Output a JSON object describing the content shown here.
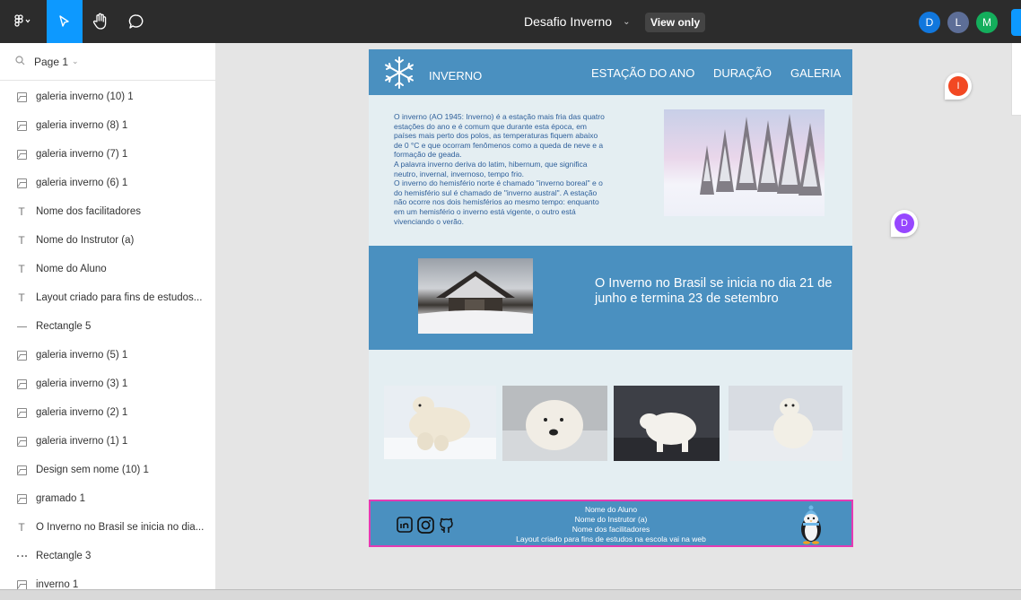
{
  "topbar": {
    "file_title": "Desafio Inverno",
    "view_only_label": "View only",
    "avatars": [
      {
        "initial": "D",
        "color": "#1177dd"
      },
      {
        "initial": "L",
        "color": "#5d6e97"
      },
      {
        "initial": "M",
        "color": "#14ae5c"
      }
    ]
  },
  "leftpanel": {
    "page_label": "Page 1",
    "layers": [
      {
        "icon": "image-icon",
        "label": "galeria inverno (10) 1"
      },
      {
        "icon": "image-icon",
        "label": "galeria inverno (8) 1"
      },
      {
        "icon": "image-icon",
        "label": "galeria inverno (7) 1"
      },
      {
        "icon": "image-icon",
        "label": "galeria inverno (6) 1"
      },
      {
        "icon": "text-icon",
        "label": "Nome dos facilitadores"
      },
      {
        "icon": "text-icon",
        "label": "Nome do Instrutor (a)"
      },
      {
        "icon": "text-icon",
        "label": "Nome do Aluno"
      },
      {
        "icon": "text-icon",
        "label": "Layout criado para fins de estudos..."
      },
      {
        "icon": "line-icon",
        "label": "Rectangle 5"
      },
      {
        "icon": "image-icon",
        "label": "galeria inverno (5) 1"
      },
      {
        "icon": "image-icon",
        "label": "galeria inverno (3) 1"
      },
      {
        "icon": "image-icon",
        "label": "galeria inverno (2) 1"
      },
      {
        "icon": "image-icon",
        "label": "galeria inverno (1) 1"
      },
      {
        "icon": "image-icon",
        "label": "Design sem nome (10) 1"
      },
      {
        "icon": "image-icon",
        "label": "gramado 1"
      },
      {
        "icon": "text-icon",
        "label": "O Inverno no Brasil se inicia no dia..."
      },
      {
        "icon": "dashed-line-icon",
        "label": "Rectangle 3"
      },
      {
        "icon": "image-icon",
        "label": "inverno 1"
      }
    ]
  },
  "design": {
    "brand": "INVERNO",
    "nav": [
      "ESTAÇÃO DO ANO",
      "DURAÇÃO",
      "GALERIA"
    ],
    "intro_lines": [
      "O inverno (AO 1945: Inverno) é a estação mais fria das quatro",
      "estações do ano e é comum que durante esta época, em",
      "países mais perto dos polos, as temperaturas fiquem abaixo",
      "de 0 °C e que ocorram fenômenos como a queda de neve e a",
      "formação de geada.",
      "A palavra inverno deriva do latim, hibernum, que significa",
      "neutro, invernal, invernoso, tempo frio.",
      "O inverno do hemisfério norte é chamado \"inverno boreal\" e o",
      "do hemisfério sul é chamado de \"inverno austral\". A estação",
      "não ocorre nos dois hemisférios ao mesmo tempo: enquanto",
      "em um hemisfério o inverno está vigente, o outro está",
      "vivenciando o verão."
    ],
    "band_text": "O Inverno no Brasil  se inicia no dia 21 de junho e termina 23 de setembro",
    "footer_lines": [
      "Nome do Aluno",
      "Nome do Instrutor (a)",
      "Nome dos facilitadores",
      "Layout criado para fins de estudos na escola vai na web"
    ]
  },
  "comments": [
    {
      "initial": "I",
      "color": "#f24822"
    },
    {
      "initial": "D",
      "color": "#9747ff"
    }
  ],
  "colors": {
    "accent": "#0d99ff",
    "header_blue": "#4a90c0",
    "frame_bg": "#e4eef2",
    "selection_pink": "#e53ab3"
  }
}
